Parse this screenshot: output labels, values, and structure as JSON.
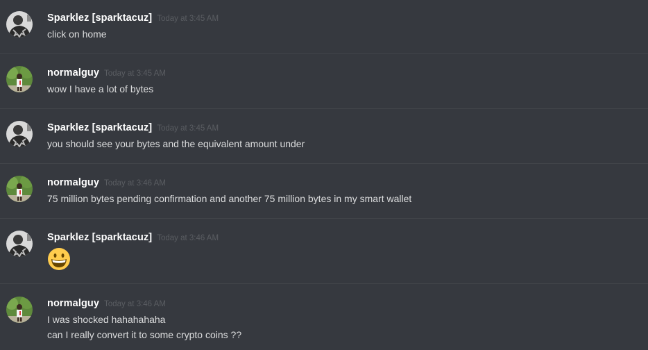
{
  "messages": [
    {
      "author": "Sparklez [sparktacuz]",
      "avatar_icon": "avatar-sparklez-icon",
      "timestamp": "Today at 3:45 AM",
      "lines": [
        "click on home"
      ]
    },
    {
      "author": "normalguy",
      "avatar_icon": "avatar-normalguy-icon",
      "timestamp": "Today at 3:45 AM",
      "lines": [
        "wow I have a lot of bytes"
      ]
    },
    {
      "author": "Sparklez [sparktacuz]",
      "avatar_icon": "avatar-sparklez-icon",
      "timestamp": "Today at 3:45 AM",
      "lines": [
        "you should see your bytes and the equivalent amount under"
      ]
    },
    {
      "author": "normalguy",
      "avatar_icon": "avatar-normalguy-icon",
      "timestamp": "Today at 3:46 AM",
      "lines": [
        "75 million bytes pending confirmation and another 75 million bytes in my smart wallet"
      ]
    },
    {
      "author": "Sparklez [sparktacuz]",
      "avatar_icon": "avatar-sparklez-icon",
      "timestamp": "Today at 3:46 AM",
      "emoji": "grinning-face-icon"
    },
    {
      "author": "normalguy",
      "avatar_icon": "avatar-normalguy-icon",
      "timestamp": "Today at 3:46 AM",
      "lines": [
        "I was shocked hahahahaha",
        "can I really convert it to some crypto coins ??"
      ]
    }
  ],
  "colors": {
    "background": "#36393f",
    "username": "#ffffff",
    "timestamp": "#5a5d62",
    "message_text": "#dcddde",
    "divider": "#42454a"
  }
}
